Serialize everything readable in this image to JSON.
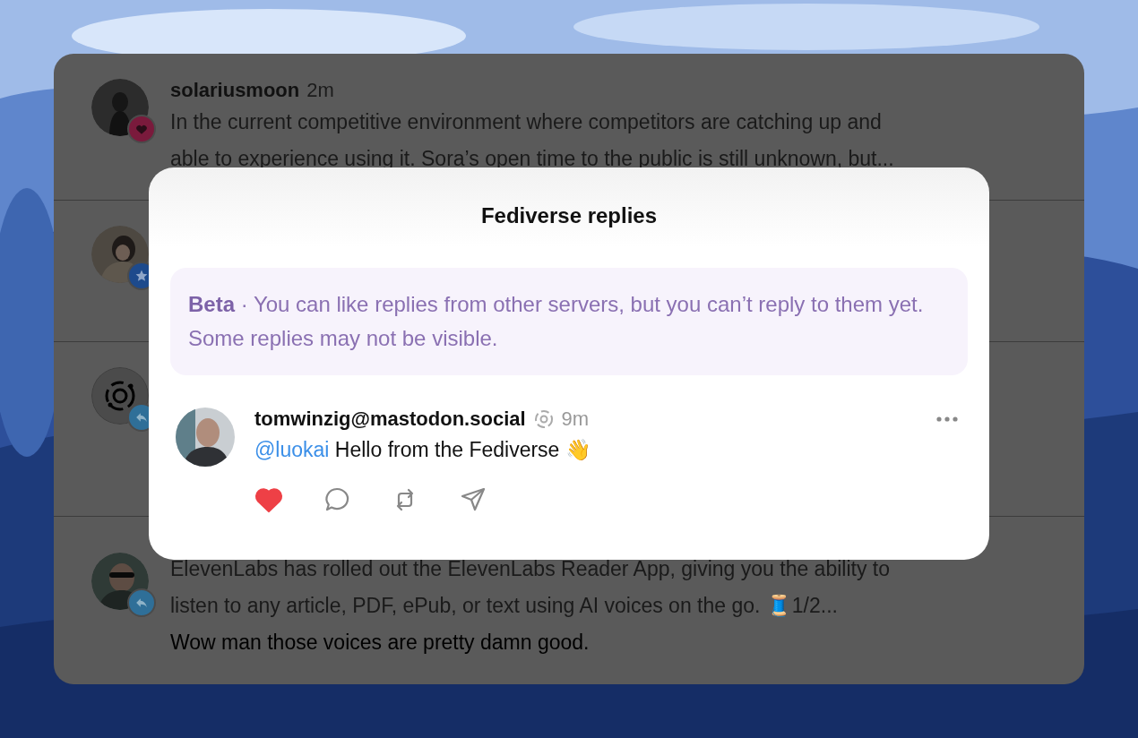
{
  "feed": [
    {
      "kind": "like",
      "author": "solariusmoon",
      "time": "2m",
      "lines": [
        "In the current competitive environment where competitors are catching up and",
        "able to experience using it. Sora’s open time to the public is still unknown, but..."
      ]
    },
    {
      "kind": "star"
    },
    {
      "kind": "reply"
    },
    {
      "kind": "reply",
      "lines": [
        "ElevenLabs has rolled out the ElevenLabs Reader App, giving you the ability to",
        "listen to any article, PDF, ePub, or text using AI voices on the go. 🧵1/2..."
      ],
      "reply": "Wow man those voices are pretty damn good."
    }
  ],
  "modal": {
    "title": "Fediverse replies",
    "notice": "**Beta** · You can like replies from other servers, but you can’t reply to them yet. Some replies may not be visible.",
    "reply": {
      "author": "tomwinzig@mastodon.social",
      "time": "9m",
      "mention": "@luokai",
      "text": "Hello from the Fediverse 👋",
      "liked": true
    }
  }
}
